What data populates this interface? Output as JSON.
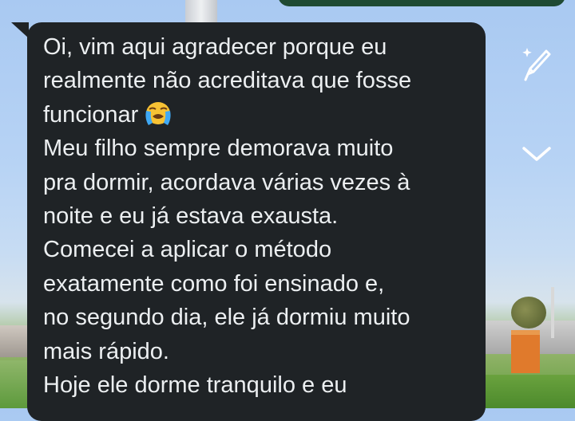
{
  "message": {
    "lines": [
      "Oi, vim aqui agradecer porque eu",
      "realmente não acreditava que fosse",
      "funcionar",
      "Meu filho sempre demorava muito",
      "pra dormir, acordava várias vezes à",
      "noite e eu já estava exausta.",
      "Comecei a aplicar o método",
      "exatamente como foi ensinado e,",
      "no segundo dia, ele já dormiu muito",
      "mais rápido.",
      "Hoje ele dorme tranquilo e eu"
    ],
    "emoji": "loudly-crying-face"
  },
  "icons": {
    "edit": "sparkle-pen-icon",
    "expand": "chevron-down-icon"
  },
  "colors": {
    "bubble": "#1f2326",
    "text": "#eceff1",
    "icon": "#ffffff",
    "sky": "#b7d3f4"
  }
}
